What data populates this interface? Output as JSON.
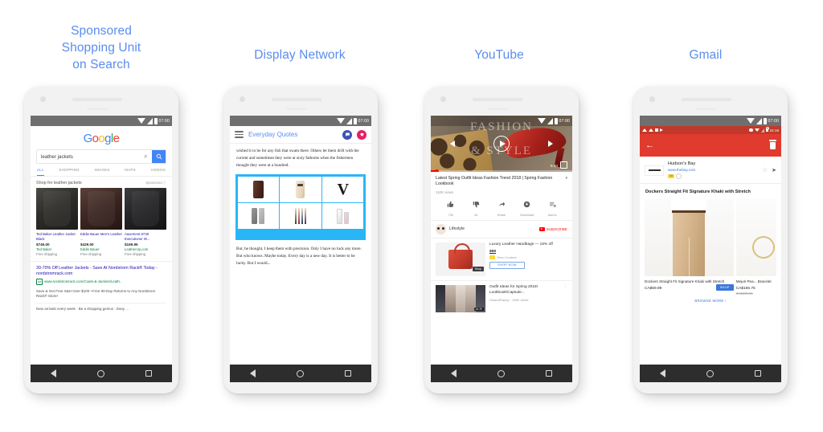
{
  "columns": [
    {
      "title": "Sponsored\nShopping Unit\non Search"
    },
    {
      "title": "Display Network"
    },
    {
      "title": "YouTube"
    },
    {
      "title": "Gmail"
    }
  ],
  "colors": {
    "heading": "#5b8dee",
    "google_blue": "#4285F4",
    "gmail_red": "#e03b2e",
    "youtube_red": "#ff0000",
    "display_blue": "#29b6f6",
    "phone_body": "#f2f2f2",
    "ad_green": "#0b8043"
  },
  "status_bar": {
    "time": "07:00"
  },
  "nav_bar": {
    "back": "back-triangle",
    "home": "home-circle",
    "recents": "square"
  },
  "search_phone": {
    "logo_letters": [
      "G",
      "o",
      "o",
      "g",
      "l",
      "e"
    ],
    "query": "leather jackets",
    "clear_label": "✕",
    "search_icon": "magnifier",
    "tabs": [
      "ALL",
      "SHOPPING",
      "IMAGES",
      "MAPS",
      "VIDEOS"
    ],
    "active_tab": "ALL",
    "shop_label": "Shop for leather jackets",
    "sponsored_label": "Sponsored ⓘ",
    "products": [
      {
        "title": "Ted Baker Leather Jacket Black",
        "price": "$745.00",
        "merchant": "Ted Baker",
        "shipping": "Free shipping"
      },
      {
        "title": "Eddie Bauer Men's Leather ...",
        "price": "$429.00",
        "merchant": "Eddie Bauer",
        "shipping": "Free shipping"
      },
      {
        "title": "Aaxement 8730 Executioner W...",
        "price": "$169.95",
        "merchant": "LeatherUp.com",
        "shipping": "Free shipping"
      }
    ],
    "text_ad": {
      "headline": "30-70% Off Leather Jackets - Save At Nordstrom Rack® Today - nordstromrack.com",
      "ad_badge": "Ad",
      "url": "www.nordstromrack.com/Coats-&-Jackets/Leath..",
      "body": "Save & Get Free S&H Over $100 +Free 90-Day Returns to Any Nordstrom Rack® Store!",
      "body2": "New arrivals every week · Be a shopping genius · Easy ..."
    }
  },
  "display_phone": {
    "site_title": "Everyday Quotes",
    "menu_icon": "hamburger-icon",
    "icon_1": "chat-bubble-icon",
    "icon_2": "heart-pin-icon",
    "body_top": "wished it to be for any fish that swam there. Others let them drift with the current and sometimes they were at sixty fathoms when the fishermen thought they were at a hundred.",
    "body_link": "swam",
    "body_bottom": "But, he thought, I keep them with precision. Only I have no luck any more. But who knows. Maybe today. Every day is a new day. It is better to be lucky. But I would...",
    "ad": {
      "close_label": "ⓧ",
      "cells": [
        "wallet",
        "bottle",
        "letter-v-logo",
        "phones",
        "brushes",
        "spray-bottles"
      ]
    }
  },
  "youtube_phone": {
    "watermark_line1": "FASHION",
    "watermark_line2": "& STYLE",
    "duration": "6:40",
    "play_icon": "play-icon",
    "prev_icon": "previous-icon",
    "next_icon": "next-icon",
    "fullscreen_icon": "fullscreen-icon",
    "video_title": "Latest Spring Outfit Ideas Fashion Trend 2018 | Spring Fashion Lookbook",
    "views": "110K views",
    "actions": [
      {
        "icon": "thumbs-up-icon",
        "label": "730"
      },
      {
        "icon": "thumbs-down-icon",
        "label": "44"
      },
      {
        "icon": "share-icon",
        "label": "Share"
      },
      {
        "icon": "download-icon",
        "label": "Download"
      },
      {
        "icon": "add-to-icon",
        "label": "Add to"
      }
    ],
    "channel": "Lifestyle",
    "subscribe_label": "SUBSCRIBE",
    "ad": {
      "title": "Luxury Leather Handbags — 15% off",
      "price": "$99",
      "brand": "Zerro Couture",
      "cta": "SHOP NOW",
      "image_tag": "Shop"
    },
    "recommended": {
      "title": "Outfit Ideas for Spring 2018! Lookbook\\Capsule...",
      "meta": "HolandFlashy · 156K views",
      "duration": "16:39"
    }
  },
  "gmail_phone": {
    "sys_time": "15:16",
    "back_icon": "arrow-left-icon",
    "delete_icon": "trash-icon",
    "sender": "Hudson's Bay",
    "sender_url": "www.thebay.com",
    "ad_chip": "Ad",
    "star_icon": "star-icon",
    "forward_icon": "forward-icon",
    "subject": "Dockers Straight Fit Signature Khaki with Stretch",
    "products": [
      {
        "title": "Dockers Straight Fit Signature Khaki with Stretch",
        "price": "CA$59.99",
        "old_price": "",
        "cta": "SHOP"
      },
      {
        "title": "Mejuri Pea... Bracelet",
        "price": "CA$165.75",
        "old_price": "CA$195.00",
        "cta": ""
      }
    ],
    "browse_more": "BROWSE MORE ›"
  }
}
